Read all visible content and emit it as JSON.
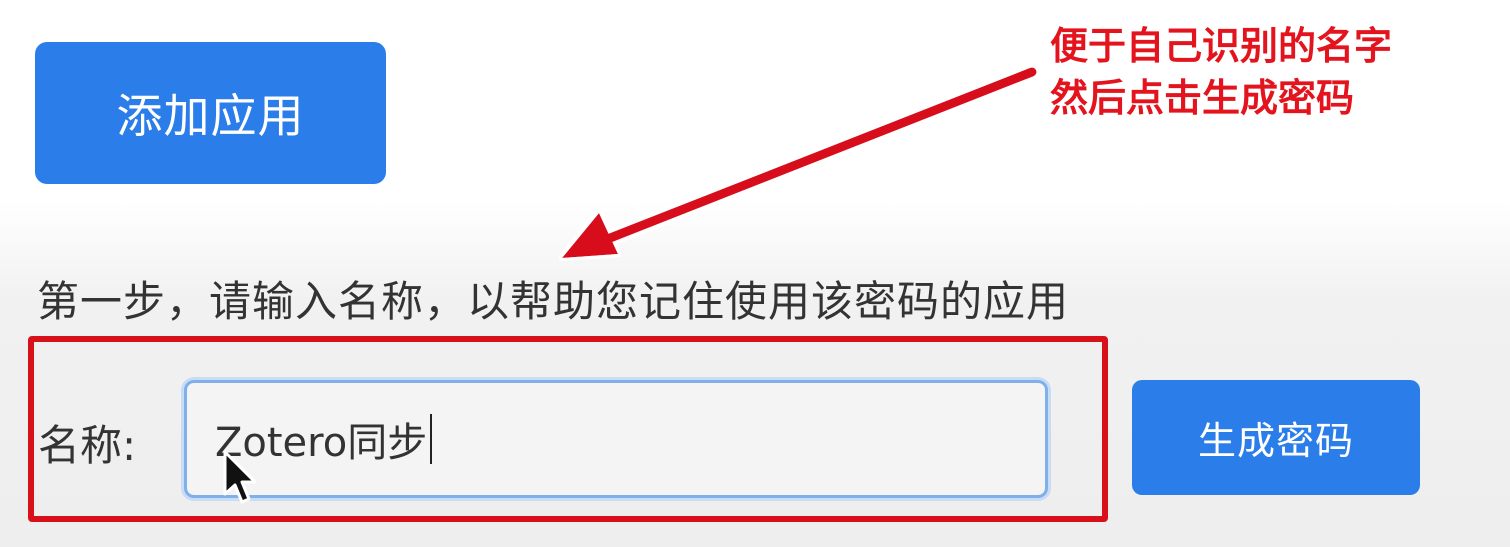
{
  "toolbar": {
    "add_app_label": "添加应用"
  },
  "annotation": {
    "line1": "便于自己识别的名字",
    "line2": "然后点击生成密码",
    "color": "#e4141e"
  },
  "step1": {
    "instruction": "第一步，请输入名称，以帮助您记住使用该密码的应用"
  },
  "form": {
    "name_label": "名称:",
    "name_value": "Zotero同步",
    "generate_label": "生成密码"
  },
  "colors": {
    "primary_button": "#2b7de9",
    "highlight_border": "#d8101a"
  },
  "icons": {
    "arrow": "annotation-arrow-icon",
    "cursor": "mouse-pointer-icon"
  }
}
